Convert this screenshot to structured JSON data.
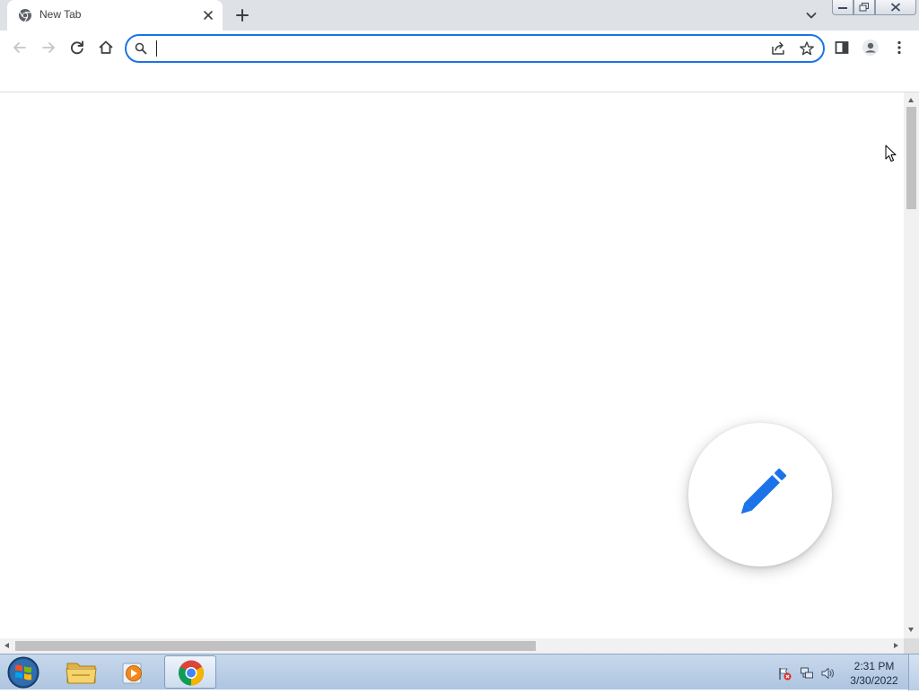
{
  "browser": {
    "tab": {
      "title": "New Tab",
      "favicon": "chrome-icon"
    },
    "new_tab_icon": "plus-icon",
    "tab_search_icon": "chevron-down-icon",
    "window_controls": [
      "minimize-icon",
      "restore-icon",
      "close-icon"
    ],
    "toolbar": {
      "back_icon": "arrow-left-icon",
      "forward_icon": "arrow-right-icon",
      "reload_icon": "reload-icon",
      "home_icon": "home-icon",
      "side_panel_icon": "side-panel-icon",
      "profile_icon": "profile-icon",
      "menu_icon": "kebab-menu-icon"
    },
    "omnibox": {
      "value": "",
      "placeholder": "",
      "search_icon": "search-icon",
      "share_icon": "share-icon",
      "bookmark_icon": "star-icon"
    }
  },
  "page": {
    "fab_icon": "pencil-icon",
    "accent": "#1a73e8"
  },
  "taskbar": {
    "apps": [
      "file-explorer-icon",
      "media-player-icon",
      "chrome-icon"
    ],
    "active_app": "chrome-icon",
    "tray": [
      "action-center-flag-icon",
      "network-icon",
      "volume-icon"
    ],
    "time": "2:31 PM",
    "date": "3/30/2022"
  }
}
